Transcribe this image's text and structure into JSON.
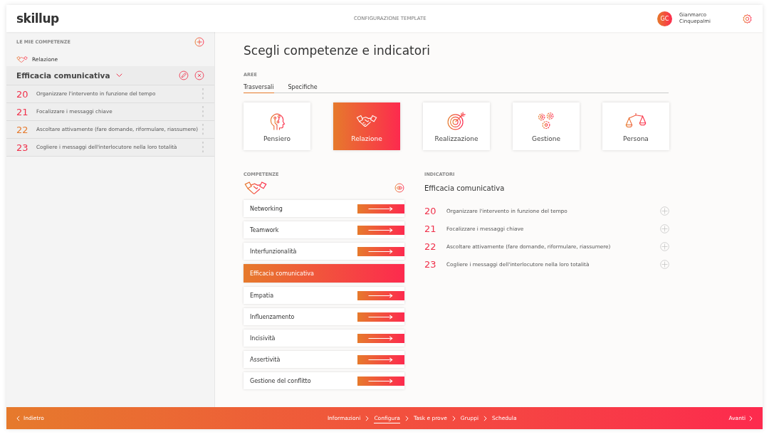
{
  "header": {
    "logo": "skillup",
    "title": "CONFIGURAZIONE TEMPLATE",
    "user": {
      "initials": "GC",
      "first_name": "Gianmarco",
      "last_name": "Cinquepalmi"
    }
  },
  "sidebar": {
    "heading": "LE MIE COMPETENZE",
    "area": "Relazione",
    "competence": "Efficacia comunicativa",
    "expanded": true,
    "indicators": [
      {
        "number": "20",
        "text": "Organizzare l'intervento in funzione del tempo",
        "color": "#f0304a"
      },
      {
        "number": "21",
        "text": "Focalizzare i messaggi chiave",
        "color": "#f0304a"
      },
      {
        "number": "22",
        "text": "Ascoltare attivamente (fare domande, riformulare, riassumere)",
        "color": "#e67a2c"
      },
      {
        "number": "23",
        "text": "Cogliere i messaggi dell'interlocutore nella loro totalità",
        "color": "#f0304a"
      }
    ]
  },
  "main": {
    "title": "Scegli competenze e indicatori",
    "areas_label": "AREE",
    "tabs": [
      {
        "label": "Trasversali",
        "selected": true
      },
      {
        "label": "Specifiche",
        "selected": false
      }
    ],
    "areas": [
      {
        "label": "Pensiero",
        "kind": "head",
        "selected": false
      },
      {
        "label": "Relazione",
        "kind": "handshake",
        "selected": true
      },
      {
        "label": "Realizzazione",
        "kind": "target",
        "selected": false
      },
      {
        "label": "Gestione",
        "kind": "gears",
        "selected": false
      },
      {
        "label": "Persona",
        "kind": "scale",
        "selected": false
      }
    ],
    "competences_label": "COMPETENZE",
    "competences": [
      {
        "label": "Networking",
        "selected": false
      },
      {
        "label": "Teamwork",
        "selected": false
      },
      {
        "label": "Interfunzionalità",
        "selected": false
      },
      {
        "label": "Efficacia comunicativa",
        "selected": true
      },
      {
        "label": "Empatia",
        "selected": false
      },
      {
        "label": "Influenzamento",
        "selected": false
      },
      {
        "label": "Incisività",
        "selected": false
      },
      {
        "label": "Assertività",
        "selected": false
      },
      {
        "label": "Gestione del conflitto",
        "selected": false
      }
    ],
    "indicators_label": "INDICATORI",
    "indicators_title": "Efficacia comunicativa",
    "indicators": [
      {
        "number": "20",
        "text": "Organizzare l'intervento in funzione del tempo"
      },
      {
        "number": "21",
        "text": "Focalizzare i messaggi chiave"
      },
      {
        "number": "22",
        "text": "Ascoltare attivamente (fare domande, riformulare, riassumere)"
      },
      {
        "number": "23",
        "text": "Cogliere i messaggi dell'interlocutore nella loro totalità"
      }
    ]
  },
  "footer": {
    "back": "Indietro",
    "next": "Avanti",
    "steps": [
      {
        "label": "Informazioni",
        "selected": false
      },
      {
        "label": "Configura",
        "selected": true
      },
      {
        "label": "Task e prove",
        "selected": false
      },
      {
        "label": "Gruppi",
        "selected": false
      },
      {
        "label": "Schedula",
        "selected": false
      }
    ]
  }
}
